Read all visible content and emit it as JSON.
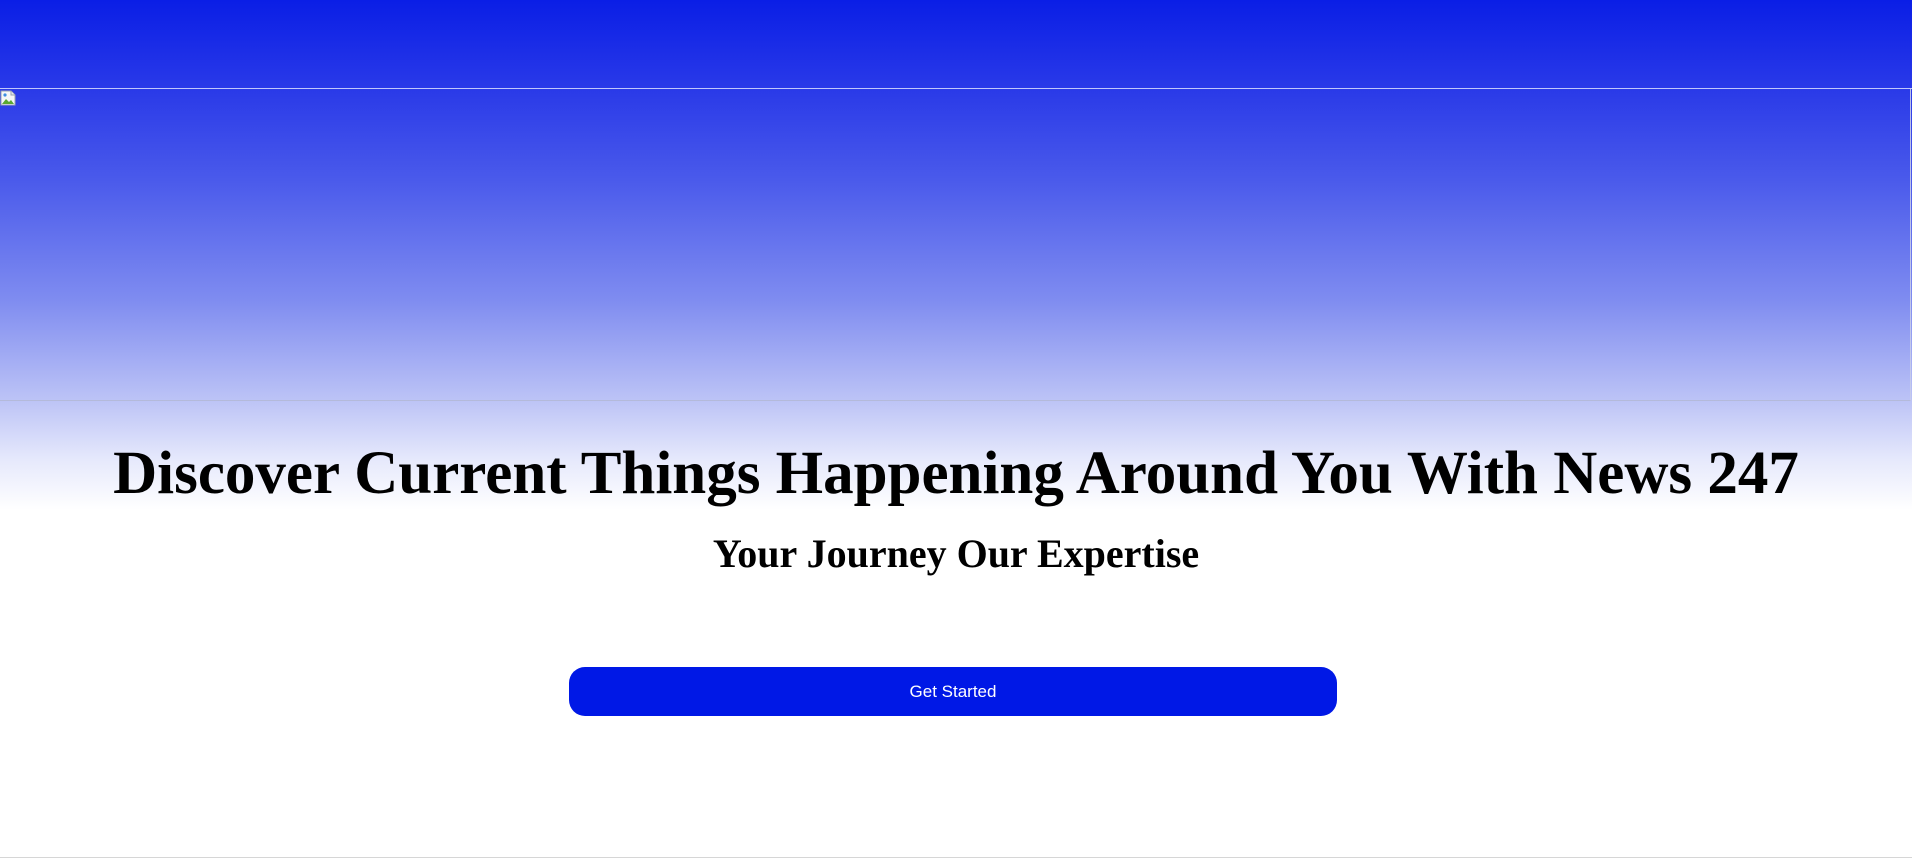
{
  "hero": {
    "image_icon": "broken-image-icon",
    "headline": "Discover Current Things Happening Around You With News 247",
    "subheadline": "Your Journey Our Expertise",
    "cta_label": "Get Started"
  },
  "colors": {
    "gradient_top": "#0a1ee6",
    "button_bg": "#0018e6",
    "button_text": "#ffffff",
    "heading_text": "#000000"
  }
}
